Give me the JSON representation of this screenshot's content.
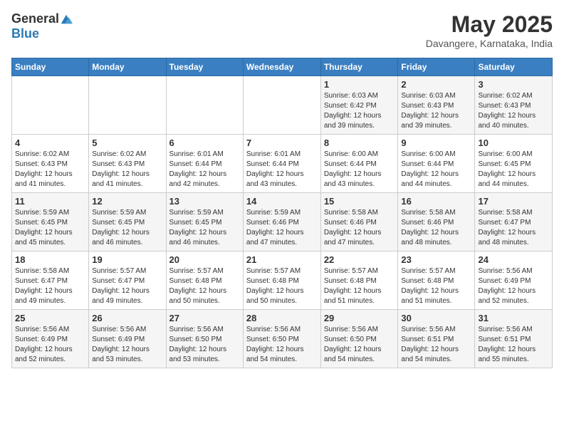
{
  "logo": {
    "general": "General",
    "blue": "Blue"
  },
  "header": {
    "month": "May 2025",
    "location": "Davangere, Karnataka, India"
  },
  "weekdays": [
    "Sunday",
    "Monday",
    "Tuesday",
    "Wednesday",
    "Thursday",
    "Friday",
    "Saturday"
  ],
  "weeks": [
    [
      {
        "day": "",
        "info": ""
      },
      {
        "day": "",
        "info": ""
      },
      {
        "day": "",
        "info": ""
      },
      {
        "day": "",
        "info": ""
      },
      {
        "day": "1",
        "info": "Sunrise: 6:03 AM\nSunset: 6:42 PM\nDaylight: 12 hours\nand 39 minutes."
      },
      {
        "day": "2",
        "info": "Sunrise: 6:03 AM\nSunset: 6:43 PM\nDaylight: 12 hours\nand 39 minutes."
      },
      {
        "day": "3",
        "info": "Sunrise: 6:02 AM\nSunset: 6:43 PM\nDaylight: 12 hours\nand 40 minutes."
      }
    ],
    [
      {
        "day": "4",
        "info": "Sunrise: 6:02 AM\nSunset: 6:43 PM\nDaylight: 12 hours\nand 41 minutes."
      },
      {
        "day": "5",
        "info": "Sunrise: 6:02 AM\nSunset: 6:43 PM\nDaylight: 12 hours\nand 41 minutes."
      },
      {
        "day": "6",
        "info": "Sunrise: 6:01 AM\nSunset: 6:44 PM\nDaylight: 12 hours\nand 42 minutes."
      },
      {
        "day": "7",
        "info": "Sunrise: 6:01 AM\nSunset: 6:44 PM\nDaylight: 12 hours\nand 43 minutes."
      },
      {
        "day": "8",
        "info": "Sunrise: 6:00 AM\nSunset: 6:44 PM\nDaylight: 12 hours\nand 43 minutes."
      },
      {
        "day": "9",
        "info": "Sunrise: 6:00 AM\nSunset: 6:44 PM\nDaylight: 12 hours\nand 44 minutes."
      },
      {
        "day": "10",
        "info": "Sunrise: 6:00 AM\nSunset: 6:45 PM\nDaylight: 12 hours\nand 44 minutes."
      }
    ],
    [
      {
        "day": "11",
        "info": "Sunrise: 5:59 AM\nSunset: 6:45 PM\nDaylight: 12 hours\nand 45 minutes."
      },
      {
        "day": "12",
        "info": "Sunrise: 5:59 AM\nSunset: 6:45 PM\nDaylight: 12 hours\nand 46 minutes."
      },
      {
        "day": "13",
        "info": "Sunrise: 5:59 AM\nSunset: 6:45 PM\nDaylight: 12 hours\nand 46 minutes."
      },
      {
        "day": "14",
        "info": "Sunrise: 5:59 AM\nSunset: 6:46 PM\nDaylight: 12 hours\nand 47 minutes."
      },
      {
        "day": "15",
        "info": "Sunrise: 5:58 AM\nSunset: 6:46 PM\nDaylight: 12 hours\nand 47 minutes."
      },
      {
        "day": "16",
        "info": "Sunrise: 5:58 AM\nSunset: 6:46 PM\nDaylight: 12 hours\nand 48 minutes."
      },
      {
        "day": "17",
        "info": "Sunrise: 5:58 AM\nSunset: 6:47 PM\nDaylight: 12 hours\nand 48 minutes."
      }
    ],
    [
      {
        "day": "18",
        "info": "Sunrise: 5:58 AM\nSunset: 6:47 PM\nDaylight: 12 hours\nand 49 minutes."
      },
      {
        "day": "19",
        "info": "Sunrise: 5:57 AM\nSunset: 6:47 PM\nDaylight: 12 hours\nand 49 minutes."
      },
      {
        "day": "20",
        "info": "Sunrise: 5:57 AM\nSunset: 6:48 PM\nDaylight: 12 hours\nand 50 minutes."
      },
      {
        "day": "21",
        "info": "Sunrise: 5:57 AM\nSunset: 6:48 PM\nDaylight: 12 hours\nand 50 minutes."
      },
      {
        "day": "22",
        "info": "Sunrise: 5:57 AM\nSunset: 6:48 PM\nDaylight: 12 hours\nand 51 minutes."
      },
      {
        "day": "23",
        "info": "Sunrise: 5:57 AM\nSunset: 6:48 PM\nDaylight: 12 hours\nand 51 minutes."
      },
      {
        "day": "24",
        "info": "Sunrise: 5:56 AM\nSunset: 6:49 PM\nDaylight: 12 hours\nand 52 minutes."
      }
    ],
    [
      {
        "day": "25",
        "info": "Sunrise: 5:56 AM\nSunset: 6:49 PM\nDaylight: 12 hours\nand 52 minutes."
      },
      {
        "day": "26",
        "info": "Sunrise: 5:56 AM\nSunset: 6:49 PM\nDaylight: 12 hours\nand 53 minutes."
      },
      {
        "day": "27",
        "info": "Sunrise: 5:56 AM\nSunset: 6:50 PM\nDaylight: 12 hours\nand 53 minutes."
      },
      {
        "day": "28",
        "info": "Sunrise: 5:56 AM\nSunset: 6:50 PM\nDaylight: 12 hours\nand 54 minutes."
      },
      {
        "day": "29",
        "info": "Sunrise: 5:56 AM\nSunset: 6:50 PM\nDaylight: 12 hours\nand 54 minutes."
      },
      {
        "day": "30",
        "info": "Sunrise: 5:56 AM\nSunset: 6:51 PM\nDaylight: 12 hours\nand 54 minutes."
      },
      {
        "day": "31",
        "info": "Sunrise: 5:56 AM\nSunset: 6:51 PM\nDaylight: 12 hours\nand 55 minutes."
      }
    ]
  ]
}
